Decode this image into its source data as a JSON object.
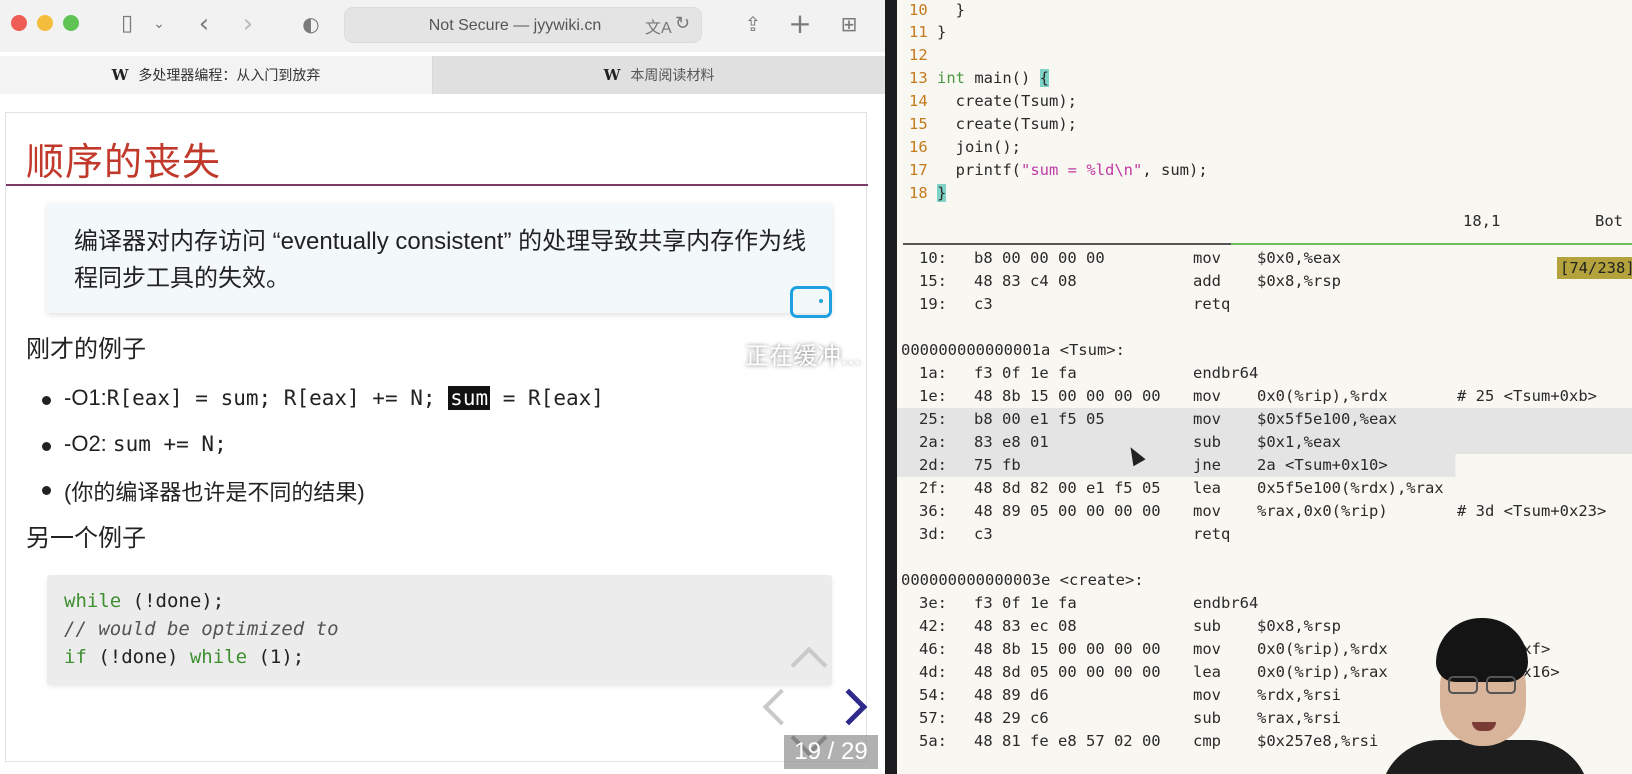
{
  "browser": {
    "address": "Not Secure — jyywiki.cn",
    "tabs": [
      {
        "label": "多处理器编程：从入门到放弃"
      },
      {
        "label": "本周阅读材料"
      }
    ]
  },
  "slide": {
    "title": "顺序的丧失",
    "callout": "编译器对内存访问 “eventually consistent” 的处理导致共享内存作为线程同步工具的失效。",
    "heading1": "刚才的例子",
    "bullets": [
      {
        "label": "-O1:",
        "code_a": "R[eax] = sum; R[eax] += N; ",
        "code_hl": "sum",
        "code_b": " = R[eax]"
      },
      {
        "label": "-O2:",
        "code_a": "sum += N;"
      },
      {
        "label": "(你的编译器也许是不同的结果)"
      }
    ],
    "heading2": "另一个例子",
    "code": [
      {
        "kw": "while",
        "rest": " (!done);"
      },
      {
        "comment": "// would be optimized to"
      },
      {
        "kw1": "if",
        "mid": " (!done) ",
        "kw2": "while",
        "rest": " (1);"
      }
    ],
    "page_indicator": "19 / 29",
    "overlay_text": "正在缓冲..."
  },
  "terminal": {
    "source": [
      {
        "n": "10",
        "code": "  }"
      },
      {
        "n": "11",
        "code": "}"
      },
      {
        "n": "12",
        "code": ""
      },
      {
        "n": "13",
        "type": "int",
        "code": " main() ",
        "brace": "{"
      },
      {
        "n": "14",
        "code": "  create(Tsum);"
      },
      {
        "n": "15",
        "code": "  create(Tsum);"
      },
      {
        "n": "16",
        "code": "  join();"
      },
      {
        "n": "17",
        "pre": "  printf(",
        "str": "\"sum = %ld\\n\"",
        "post": ", sum);"
      },
      {
        "n": "18",
        "brace": "}"
      }
    ],
    "status_position": "18,1",
    "status_scroll": "Bot",
    "progress_badge": "[74/238]",
    "asm": [
      {
        "addr": "10:",
        "bytes": "b8 00 00 00 00",
        "op": "mov",
        "arg": "$0x0,%eax"
      },
      {
        "addr": "15:",
        "bytes": "48 83 c4 08",
        "op": "add",
        "arg": "$0x8,%rsp"
      },
      {
        "addr": "19:",
        "bytes": "c3",
        "op": "retq",
        "arg": ""
      },
      {
        "blank": true
      },
      {
        "symbol": "000000000000001a <Tsum>:",
        "op": "endbr64"
      },
      {
        "addr": "1a:",
        "bytes": "f3 0f 1e fa",
        "op": "endbr64",
        "arg": ""
      },
      {
        "addr": "1e:",
        "bytes": "48 8b 15 00 00 00 00",
        "op": "mov",
        "arg": "0x0(%rip),%rdx",
        "comment": "# 25 <Tsum+0xb>"
      },
      {
        "addr": "25:",
        "bytes": "b8 00 e1 f5 05",
        "op": "mov",
        "arg": "$0x5f5e100,%eax",
        "hl": "full"
      },
      {
        "addr": "2a:",
        "bytes": "83 e8 01",
        "op": "sub",
        "arg": "$0x1,%eax",
        "hl": "full"
      },
      {
        "addr": "2d:",
        "bytes": "75 fb",
        "op": "jne",
        "arg": "2a <Tsum+0x10>",
        "hl": "short"
      },
      {
        "addr": "2f:",
        "bytes": "48 8d 82 00 e1 f5 05",
        "op": "lea",
        "arg": "0x5f5e100(%rdx),%rax"
      },
      {
        "addr": "36:",
        "bytes": "48 89 05 00 00 00 00",
        "op": "mov",
        "arg": "%rax,0x0(%rip)",
        "comment": "# 3d <Tsum+0x23>"
      },
      {
        "addr": "3d:",
        "bytes": "c3",
        "op": "retq",
        "arg": ""
      },
      {
        "blank": true
      },
      {
        "symbol": "000000000000003e <create>:",
        "op": ""
      },
      {
        "addr": "3e:",
        "bytes": "f3 0f 1e fa",
        "op": "endbr64",
        "arg": ""
      },
      {
        "addr": "42:",
        "bytes": "48 83 ec 08",
        "op": "sub",
        "arg": "$0x8,%rsp"
      },
      {
        "addr": "46:",
        "bytes": "48 8b 15 00 00 00 00",
        "op": "mov",
        "arg": "0x0(%rip),%rdx",
        "comment": "reate+0xf>"
      },
      {
        "addr": "4d:",
        "bytes": "48 8d 05 00 00 00 00",
        "op": "lea",
        "arg": "0x0(%rip),%rax",
        "comment": "reate+0x16>"
      },
      {
        "addr": "54:",
        "bytes": "48 89 d6",
        "op": "mov",
        "arg": "%rdx,%rsi"
      },
      {
        "addr": "57:",
        "bytes": "48 29 c6",
        "op": "sub",
        "arg": "%rax,%rsi"
      },
      {
        "addr": "5a:",
        "bytes": "48 81 fe e8 57 02 00",
        "op": "cmp",
        "arg": "$0x257e8,%rsi"
      }
    ]
  }
}
